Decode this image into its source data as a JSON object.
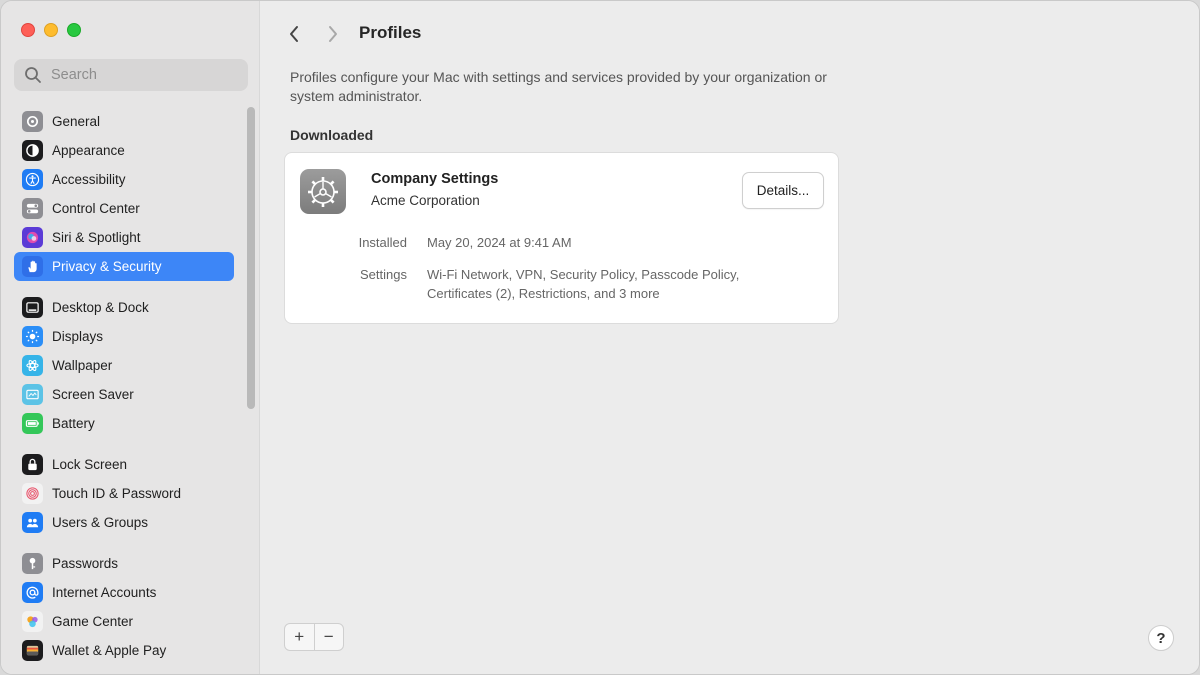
{
  "sidebar": {
    "search_placeholder": "Search",
    "groups": [
      [
        {
          "label": "General",
          "icon": "gear-icon",
          "color": "#8e8e93"
        },
        {
          "label": "Appearance",
          "icon": "appearance-icon",
          "color": "#1c1c1e"
        },
        {
          "label": "Accessibility",
          "icon": "accessibility-icon",
          "color": "#1f7cf4"
        },
        {
          "label": "Control Center",
          "icon": "toggles-icon",
          "color": "#8e8e93"
        },
        {
          "label": "Siri & Spotlight",
          "icon": "siri-icon",
          "color": "#5b3bd6"
        },
        {
          "label": "Privacy & Security",
          "icon": "hand-icon",
          "color": "#2f6fe8",
          "selected": true
        }
      ],
      [
        {
          "label": "Desktop & Dock",
          "icon": "dock-icon",
          "color": "#1c1c1e"
        },
        {
          "label": "Displays",
          "icon": "sun-icon",
          "color": "#2b8ef7"
        },
        {
          "label": "Wallpaper",
          "icon": "flower-icon",
          "color": "#36b4e8"
        },
        {
          "label": "Screen Saver",
          "icon": "screensaver-icon",
          "color": "#5cc3e6"
        },
        {
          "label": "Battery",
          "icon": "battery-icon",
          "color": "#34c759"
        }
      ],
      [
        {
          "label": "Lock Screen",
          "icon": "lock-icon",
          "color": "#1c1c1e"
        },
        {
          "label": "Touch ID & Password",
          "icon": "fingerprint-icon",
          "color": "#f2f2f2"
        },
        {
          "label": "Users & Groups",
          "icon": "users-icon",
          "color": "#1f7cf4"
        }
      ],
      [
        {
          "label": "Passwords",
          "icon": "key-icon",
          "color": "#8e8e93"
        },
        {
          "label": "Internet Accounts",
          "icon": "at-icon",
          "color": "#1f7cf4"
        },
        {
          "label": "Game Center",
          "icon": "gamecenter-icon",
          "color": "#f2f2f2"
        },
        {
          "label": "Wallet & Apple Pay",
          "icon": "wallet-icon",
          "color": "#1c1c1e"
        }
      ]
    ]
  },
  "header": {
    "title": "Profiles"
  },
  "main": {
    "description": "Profiles configure your Mac with settings and services provided by your organization or system administrator.",
    "section_heading": "Downloaded",
    "profile": {
      "name": "Company Settings",
      "organization": "Acme Corporation",
      "details_button": "Details...",
      "installed_label": "Installed",
      "installed_value": "May 20, 2024 at 9:41 AM",
      "settings_label": "Settings",
      "settings_value": "Wi-Fi Network, VPN, Security Policy, Passcode Policy, Certificates (2), Restrictions, and 3 more"
    },
    "add_label": "+",
    "remove_label": "−",
    "help_label": "?"
  },
  "colors": {
    "accent": "#3d86f7",
    "sidebar_bg": "#e6e5e5",
    "main_bg": "#ececec"
  }
}
